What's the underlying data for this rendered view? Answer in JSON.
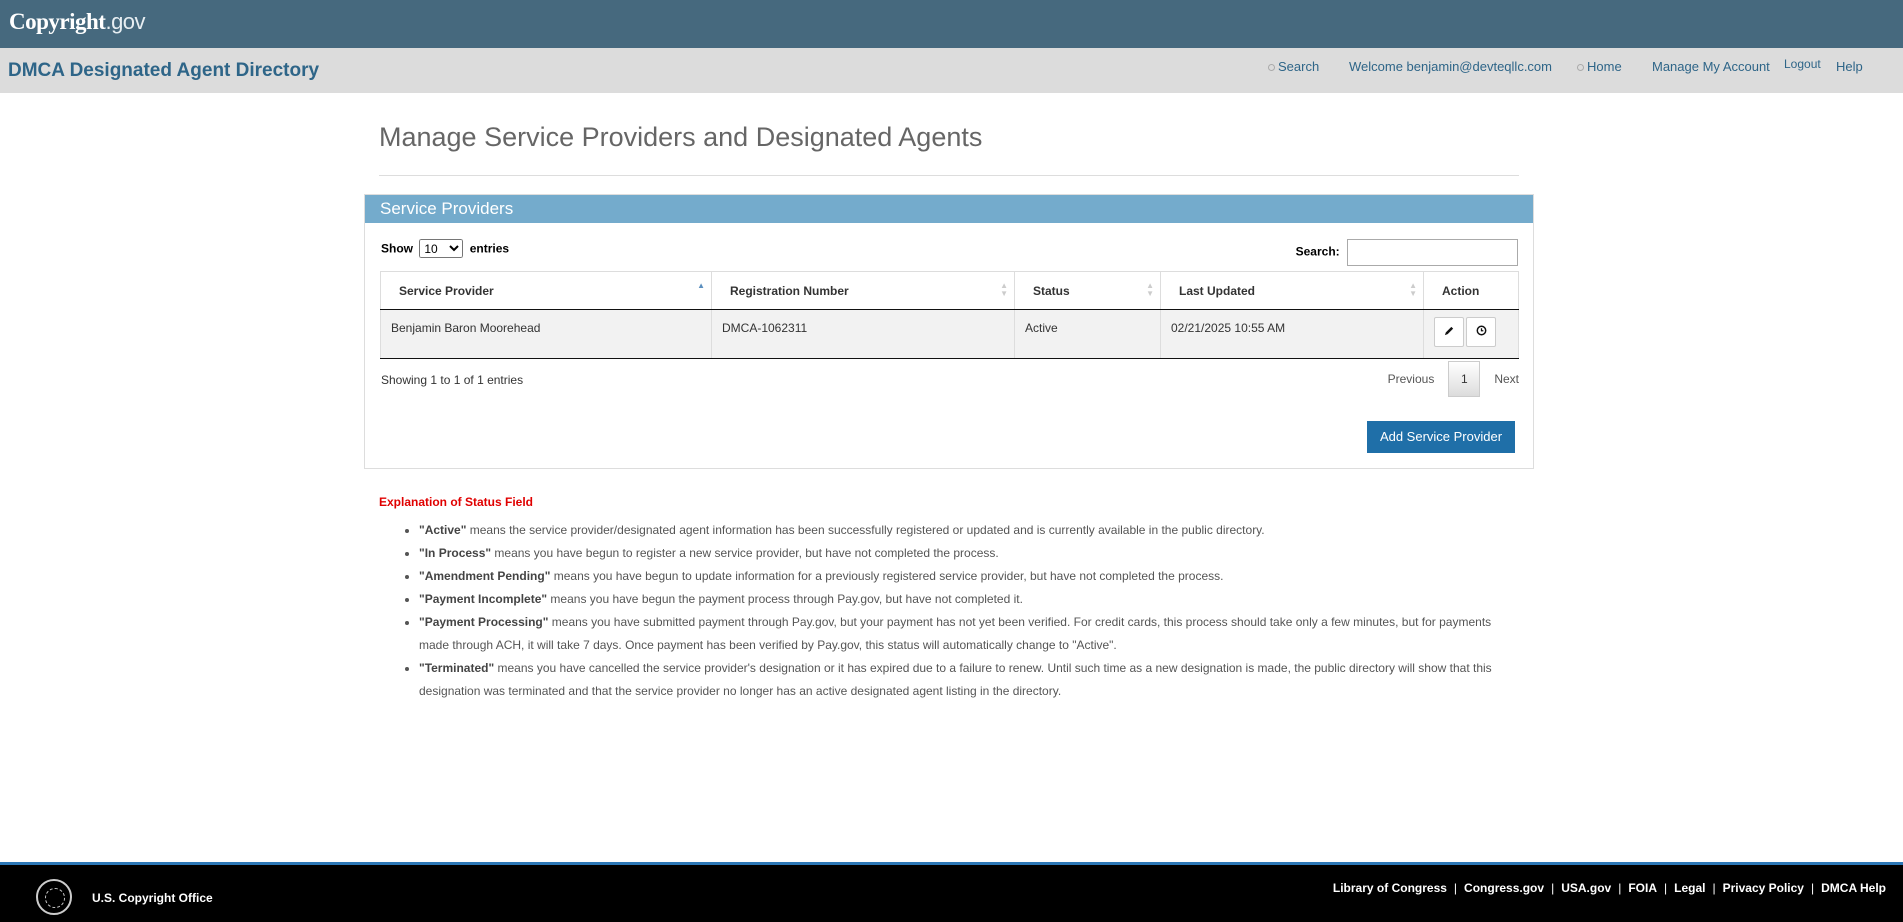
{
  "brand": {
    "logo_main": "Copyright",
    "logo_suffix": ".gov"
  },
  "header": {
    "app_title": "DMCA Designated Agent Directory",
    "nav": {
      "search": "Search",
      "welcome": "Welcome benjamin@devteqllc.com",
      "home": "Home",
      "manage_account": "Manage My Account",
      "logout": "Logout",
      "help": "Help"
    }
  },
  "page": {
    "title": "Manage Service Providers and Designated Agents"
  },
  "panel": {
    "heading": "Service Providers",
    "show_label": "Show",
    "entries_label": "entries",
    "page_size": "10",
    "search_label": "Search:",
    "search_value": "",
    "columns": {
      "provider": "Service Provider",
      "registration": "Registration Number",
      "status": "Status",
      "updated": "Last Updated",
      "action": "Action"
    },
    "rows": [
      {
        "provider": "Benjamin Baron Moorehead",
        "registration": "DMCA-1062311",
        "status": "Active",
        "updated": "02/21/2025 10:55 AM"
      }
    ],
    "showing": "Showing 1 to 1 of 1 entries",
    "pager": {
      "previous": "Previous",
      "current": "1",
      "next": "Next"
    },
    "add_button": "Add Service Provider"
  },
  "explanation": {
    "title": "Explanation of Status Field",
    "items": [
      {
        "term": "\"Active\"",
        "text": " means the service provider/designated agent information has been successfully registered or updated and is currently available in the public directory."
      },
      {
        "term": "\"In Process\"",
        "text": " means you have begun to register a new service provider, but have not completed the process."
      },
      {
        "term": "\"Amendment Pending\"",
        "text": " means you have begun to update information for a previously registered service provider, but have not completed the process."
      },
      {
        "term": "\"Payment Incomplete\"",
        "text": " means you have begun the payment process through Pay.gov, but have not completed it."
      },
      {
        "term": "\"Payment Processing\"",
        "text": " means you have submitted payment through Pay.gov, but your payment has not yet been verified. For credit cards, this process should take only a few minutes, but for payments made through ACH, it will take 7 days. Once payment has been verified by Pay.gov, this status will automatically change to \"Active\"."
      },
      {
        "term": "\"Terminated\"",
        "text": " means you have cancelled the service provider's designation or it has expired due to a failure to renew. Until such time as a new designation is made, the public directory will show that this designation was terminated and that the service provider no longer has an active designated agent listing in the directory."
      }
    ]
  },
  "footer": {
    "office": "U.S. Copyright Office",
    "links": [
      "Library of Congress",
      "Congress.gov",
      "USA.gov",
      "FOIA",
      "Legal",
      "Privacy Policy",
      "DMCA Help"
    ],
    "separator": "|"
  },
  "icons": {
    "edit": "pencil-icon",
    "history": "clock-icon",
    "search": "search-icon",
    "home": "home-icon"
  },
  "colors": {
    "topbar": "#46697e",
    "panel_head": "#74abcc",
    "primary_button": "#1f6fa8",
    "status_title": "#e00000"
  }
}
